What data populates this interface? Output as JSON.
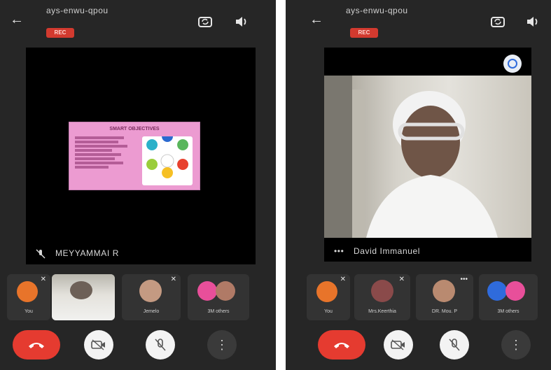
{
  "left": {
    "meeting_code": "ays-enwu-qpou",
    "rec_label": "REC",
    "main_speaker_name": "MEYYAMMAI R",
    "slide": {
      "title": "SMART OBJECTIVES"
    },
    "participants": [
      {
        "name": "You"
      },
      {
        "name": ""
      },
      {
        "name": "Jemelo"
      },
      {
        "name": "3M others"
      }
    ]
  },
  "right": {
    "meeting_code": "ays-enwu-qpou",
    "rec_label": "REC",
    "main_speaker_name": "David Immanuel",
    "participants": [
      {
        "name": "You"
      },
      {
        "name": "Mrs.Keerthia"
      },
      {
        "name": "DR. Mou. P"
      },
      {
        "name": "3M others"
      }
    ]
  },
  "icons": {
    "back": "back-arrow-icon",
    "camera_switch": "camera-switch-icon",
    "speaker": "speaker-icon",
    "end_call": "phone-hangup-icon",
    "camera": "camera-icon",
    "mic": "mic-off-icon",
    "more": "more-vertical-icon"
  },
  "colors": {
    "background": "#262626",
    "rec": "#d23a2f",
    "end_call": "#e53b30",
    "accent_orange": "#e8742a",
    "accent_pink": "#e84f9a",
    "accent_blue": "#2f6bdc",
    "slide_pink": "#ec9bd1"
  }
}
